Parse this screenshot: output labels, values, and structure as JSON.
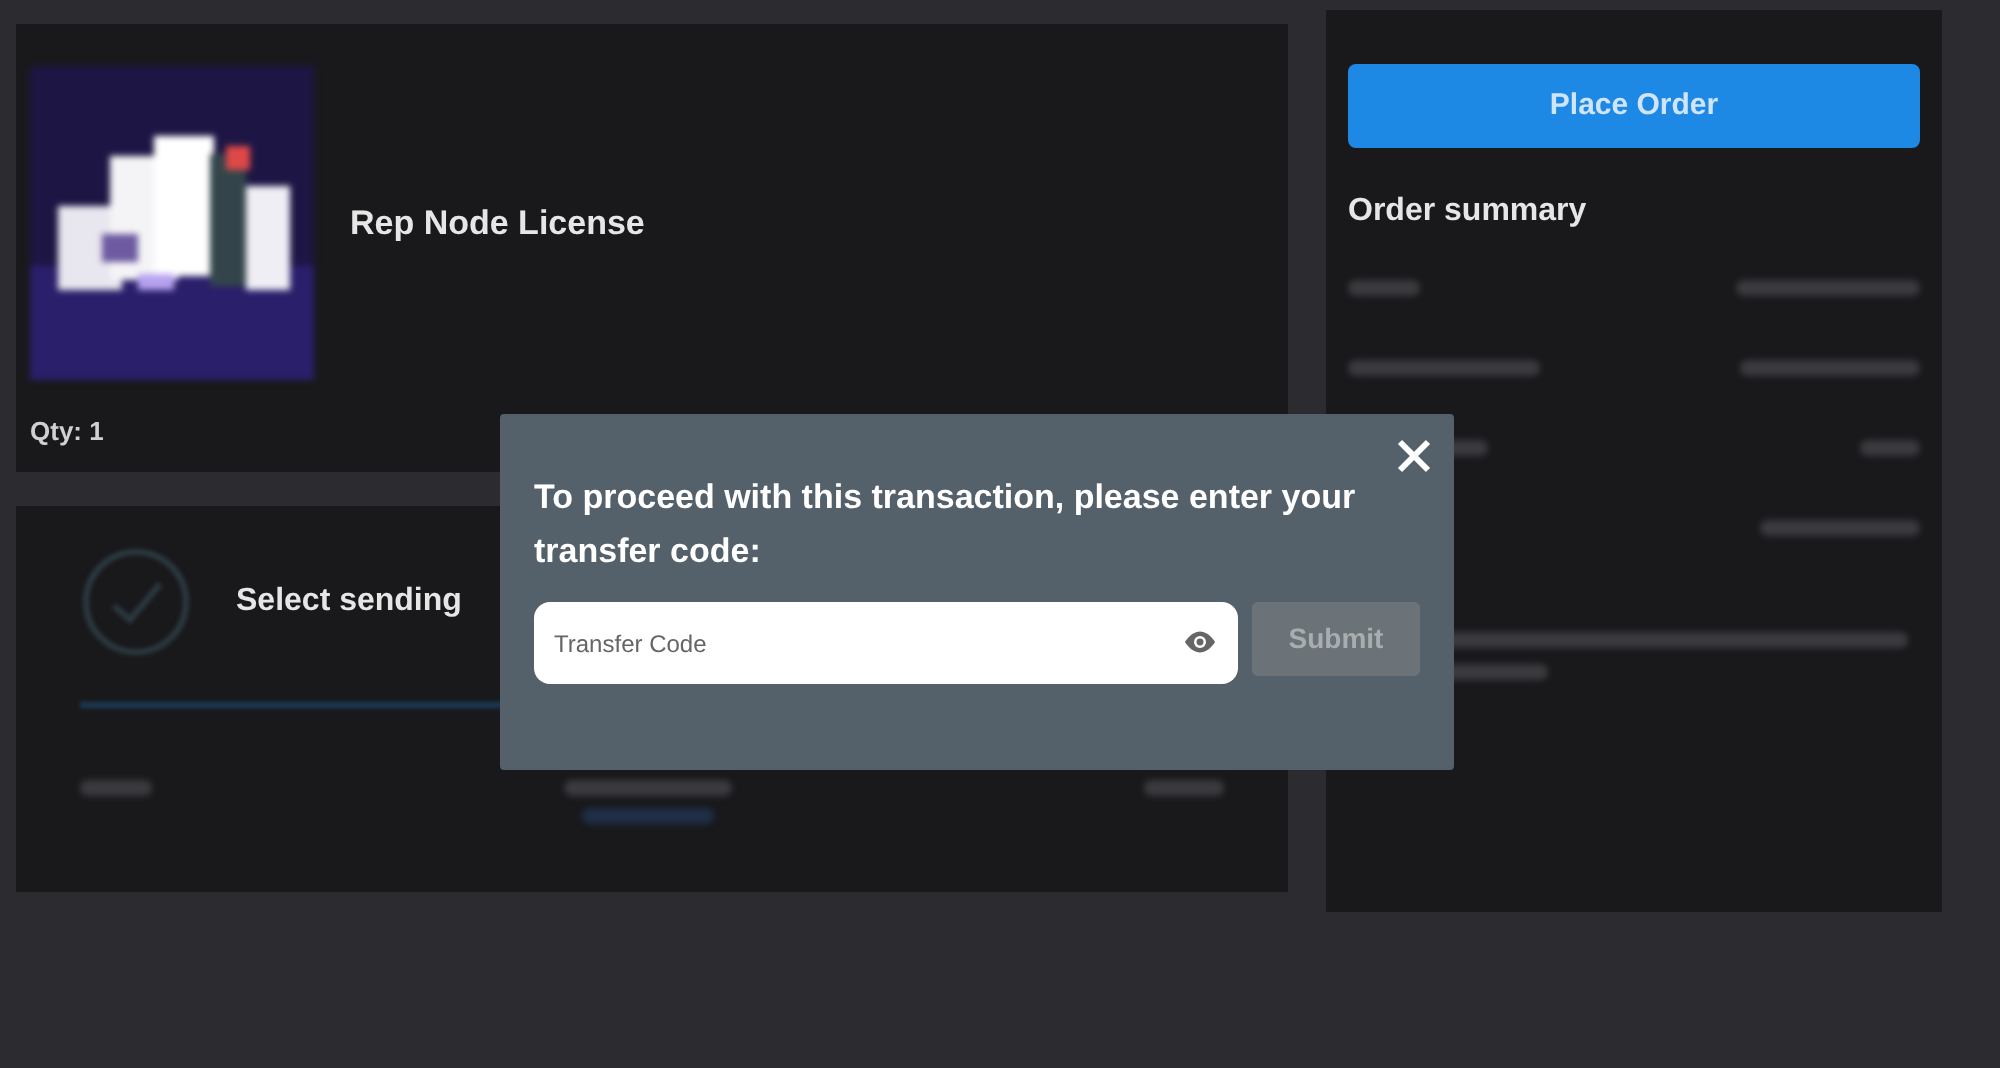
{
  "product": {
    "title": "Rep Node License",
    "quantity": "Qty: 1"
  },
  "sending": {
    "title": "Select sending"
  },
  "order": {
    "button": "Place Order",
    "summary_title": "Order summary"
  },
  "modal": {
    "message": "To proceed with this transaction, please enter your transfer code:",
    "field": {
      "placeholder": "Transfer Code"
    },
    "submit": {
      "label": "Submit",
      "disabled": true
    }
  }
}
